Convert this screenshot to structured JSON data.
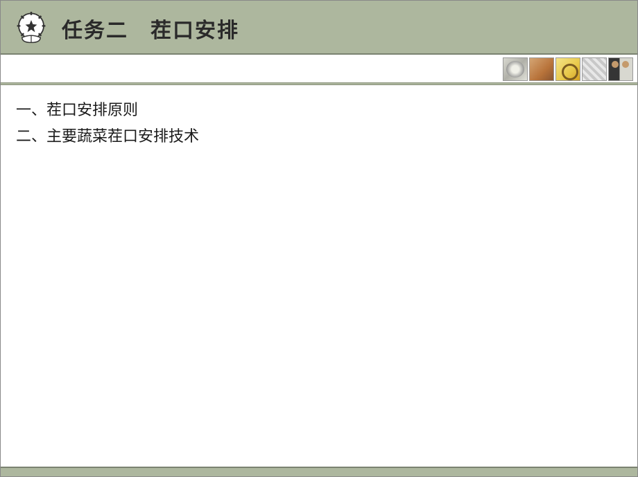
{
  "header": {
    "title": "任务二　茬口安排"
  },
  "body": {
    "lines": [
      "一、茬口安排原则",
      "二、主要蔬菜茬口安排技术"
    ]
  }
}
